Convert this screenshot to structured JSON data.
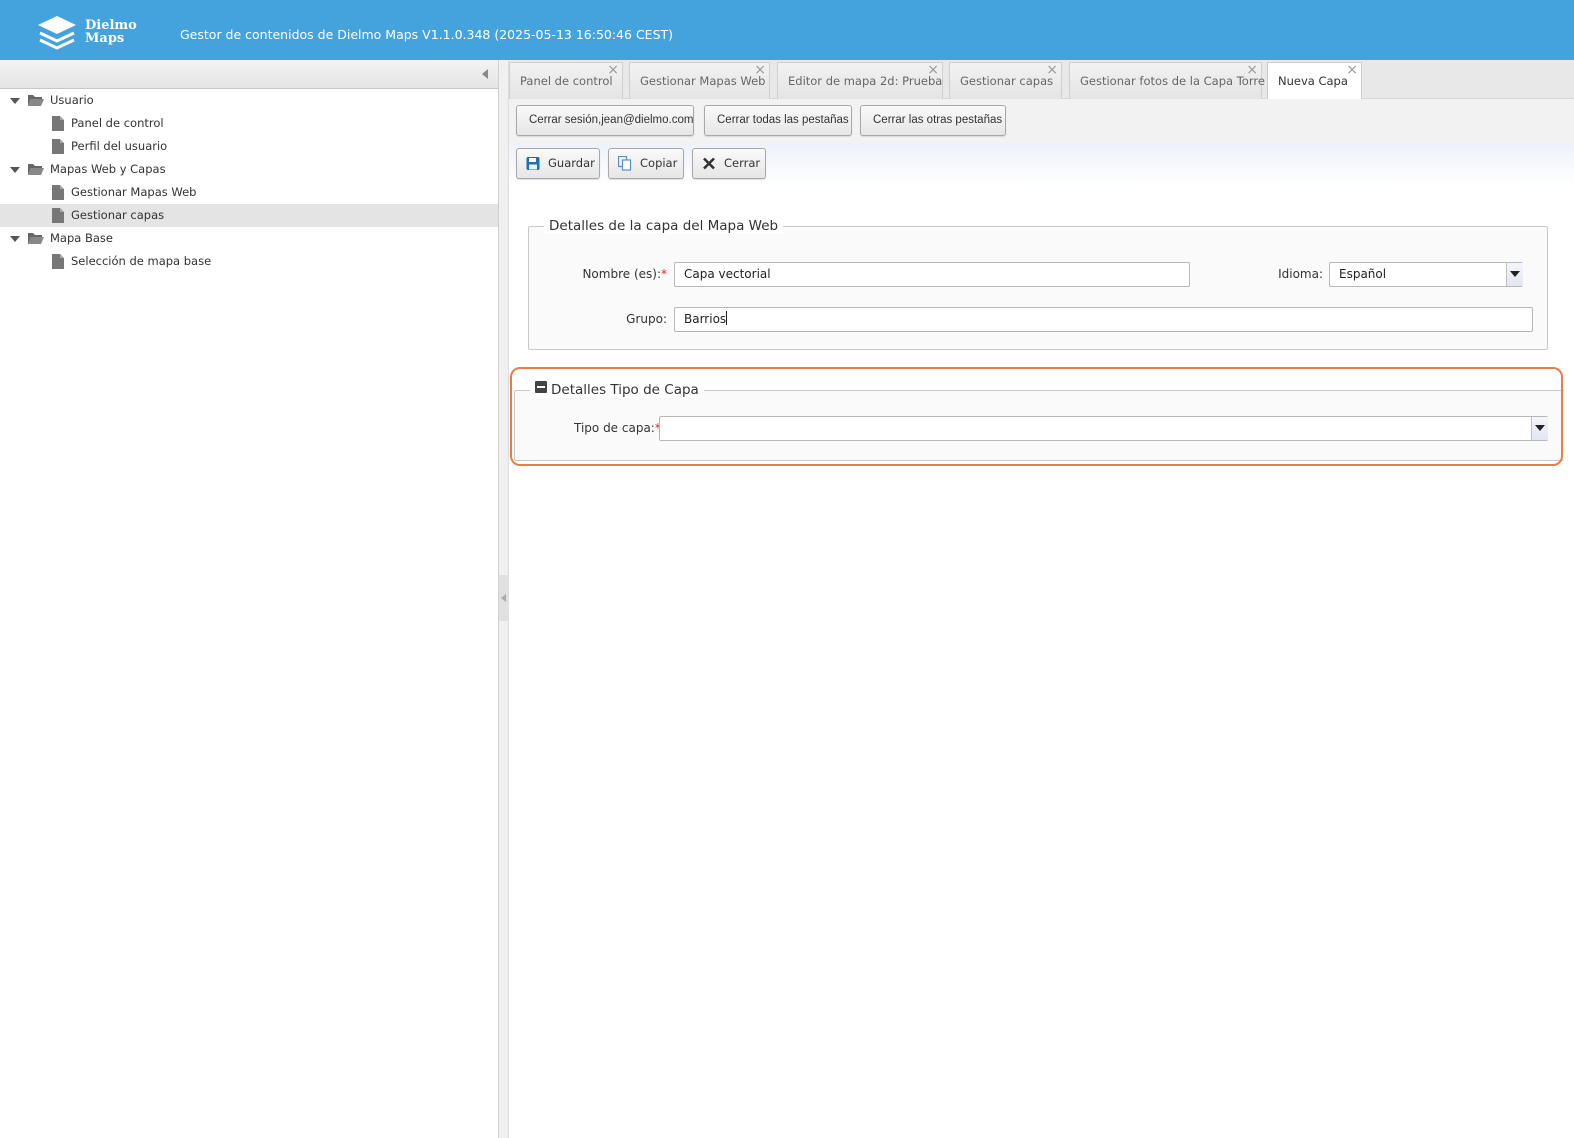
{
  "header": {
    "logo_line1": "Dielmo",
    "logo_line2": "Maps",
    "title": "Gestor de contenidos de Dielmo Maps V1.1.0.348 (2025-05-13 16:50:46 CEST)",
    "background_color": "#44a2dc"
  },
  "sidebar": {
    "tree": [
      {
        "label": "Usuario",
        "type": "folder",
        "expanded": true
      },
      {
        "label": "Panel de control",
        "type": "file"
      },
      {
        "label": "Perfil del usuario",
        "type": "file"
      },
      {
        "label": "Mapas Web y Capas",
        "type": "folder",
        "expanded": true
      },
      {
        "label": "Gestionar Mapas Web",
        "type": "file"
      },
      {
        "label": "Gestionar capas",
        "type": "file",
        "selected": true
      },
      {
        "label": "Mapa Base",
        "type": "folder",
        "expanded": true
      },
      {
        "label": "Selección de mapa base",
        "type": "file"
      }
    ]
  },
  "tabs": [
    {
      "label": "Panel de control",
      "active": false
    },
    {
      "label": "Gestionar Mapas Web",
      "active": false
    },
    {
      "label": "Editor de mapa 2d: Prueba",
      "active": false
    },
    {
      "label": "Gestionar capas",
      "active": false
    },
    {
      "label": "Gestionar fotos de la Capa Torre",
      "active": false
    },
    {
      "label": "Nueva Capa",
      "active": true
    }
  ],
  "session_toolbar": {
    "logout": "Cerrar sesión,jean@dielmo.com",
    "close_all": "Cerrar todas las pestañas",
    "close_others": "Cerrar las otras pestañas"
  },
  "form_toolbar": {
    "save": "Guardar",
    "copy": "Copiar",
    "close": "Cerrar"
  },
  "details": {
    "legend": "Detalles de la capa del Mapa Web",
    "name_label": "Nombre (es):",
    "name_value": "Capa vectorial",
    "language_label": "Idioma:",
    "language_value": "Español",
    "group_label": "Grupo:",
    "group_value": "Barrios"
  },
  "type_details": {
    "legend": "Detalles Tipo de Capa",
    "type_label": "Tipo de capa:",
    "type_value": ""
  },
  "required_mark": "*",
  "colors": {
    "highlight": "#ec7c46",
    "required": "#d8222a"
  }
}
